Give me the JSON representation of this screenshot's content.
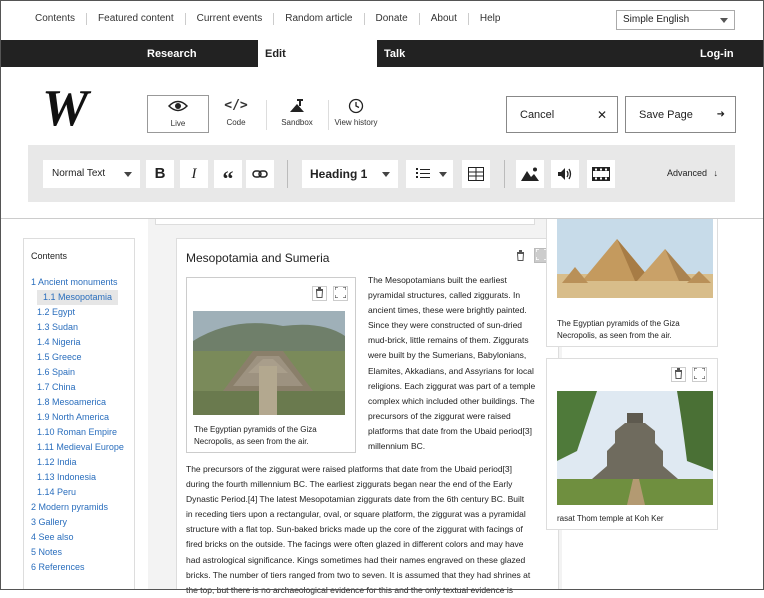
{
  "topnav": {
    "links": [
      "Contents",
      "Featured content",
      "Current events",
      "Random article",
      "Donate",
      "About",
      "Help"
    ],
    "language": "Simple English"
  },
  "mainnav": {
    "research": "Research",
    "edit": "Edit",
    "talk": "Talk",
    "login": "Log-in"
  },
  "logo": "W",
  "modes": {
    "live": "Live",
    "code": "Code",
    "sandbox": "Sandbox",
    "history": "View history"
  },
  "actions": {
    "cancel": "Cancel",
    "save": "Save Page"
  },
  "format": {
    "paragraph": "Normal Text",
    "bold": "B",
    "italic": "I",
    "quote": "“",
    "heading": "Heading 1",
    "advanced": "Advanced"
  },
  "toc": {
    "title": "Contents",
    "items": [
      "1 Ancient monuments",
      "1.1 Mesopotamia",
      "1.2 Egypt",
      "1.3 Sudan",
      "1.4 Nigeria",
      "1.5 Greece",
      "1.6 Spain",
      "1.7 China",
      "1.8 Mesoamerica",
      "1.9 North America",
      "1.10 Roman Empire",
      "1.11 Medieval Europe",
      "1.12 India",
      "1.13 Indonesia",
      "1.14 Peru",
      "2 Modern pyramids",
      "3 Gallery",
      "4 See also",
      "5 Notes",
      "6 References"
    ]
  },
  "section": {
    "title": "Mesopotamia and Sumeria",
    "figure_caption": "The Egyptian pyramids of the Giza Necropolis, as seen from the air.",
    "side_lines": [
      "The Mesopotamians built the earliest",
      "pyramidal structures, called ziggurats. In",
      "ancient times, these were brightly painted.",
      "Since they were constructed of sun-dried",
      "mud-brick, little remains of them. Ziggurats",
      "were built by the Sumerians, Babylonians,",
      "Elamites, Akkadians, and Assyrians for local",
      "religions. Each ziggurat was part of a temple",
      "complex which included other buildings. The",
      "precursors of the ziggurat were raised",
      "platforms that date from the Ubaid period[3]",
      "millennium BC."
    ],
    "body_lines": [
      "The precursors of the ziggurat were raised platforms that date from the Ubaid period[3]",
      "during the fourth millennium BC. The earliest ziggurats began near the end of the Early",
      "Dynastic Period.[4] The latest Mesopotamian ziggurats date from the 6th century BC. Built",
      "in receding tiers upon a rectangular, oval, or square platform, the ziggurat was a pyramidal",
      "structure with a flat top. Sun-baked bricks made up the core of the ziggurat with facings of",
      "fired bricks on the outside. The facings were often glazed in different colors and may have",
      "had astrological significance. Kings sometimes had their names engraved on these glazed",
      "bricks. The number of tiers ranged from two to seven. It is assumed that they had shrines at",
      "the top, but there is no archaeological evidence for this and the only textual evidence is"
    ]
  },
  "right": {
    "caption1": [
      "The Egyptian pyramids of the Giza",
      "Necropolis, as seen from the air."
    ],
    "caption2": "rasat Thom temple at Koh Ker"
  }
}
